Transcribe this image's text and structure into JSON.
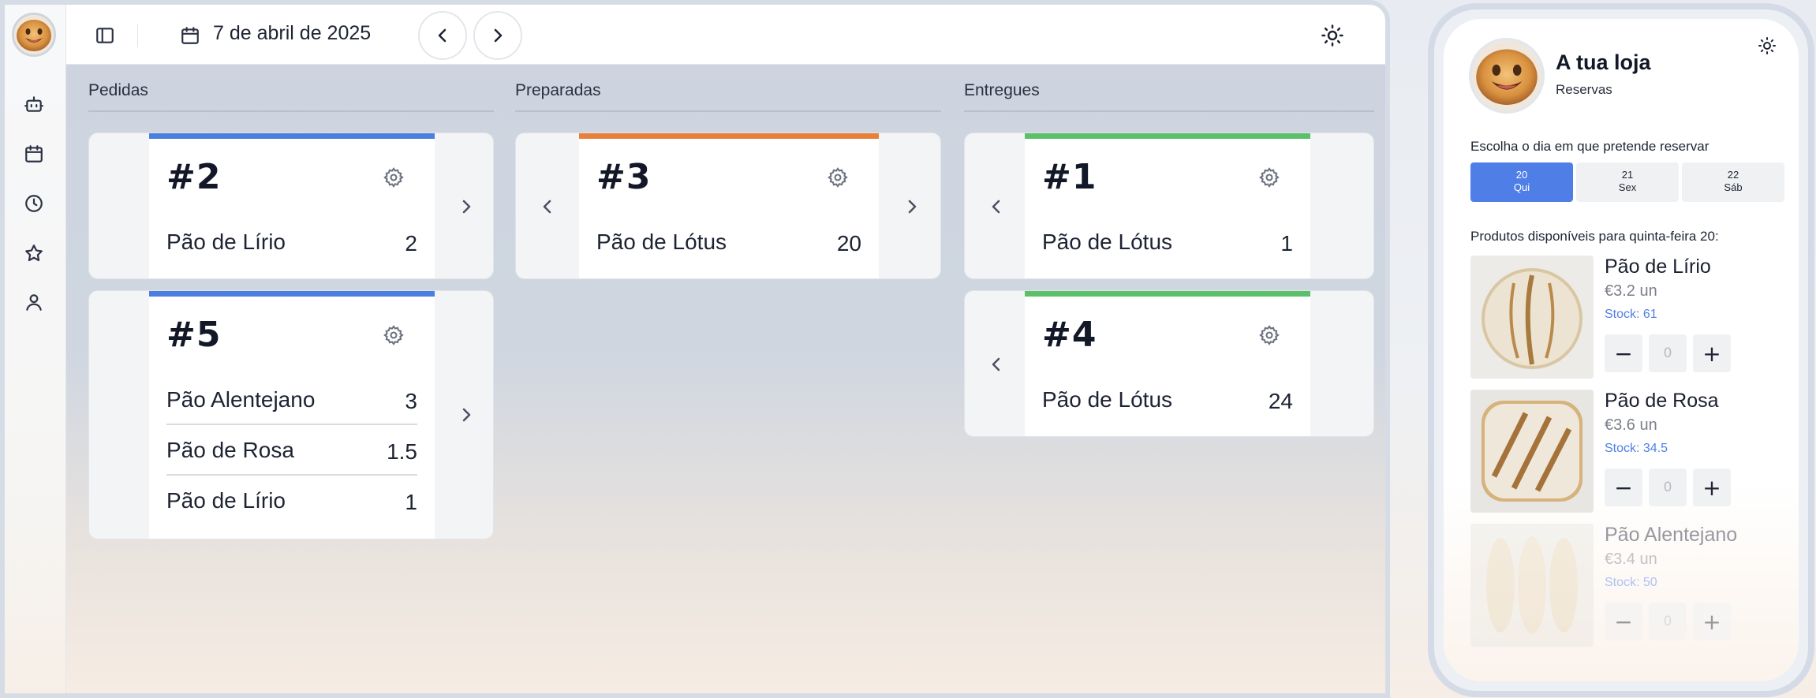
{
  "topbar": {
    "date": "7 de abril de 2025"
  },
  "columns": [
    {
      "title": "Pedidas"
    },
    {
      "title": "Preparadas"
    },
    {
      "title": "Entregues"
    }
  ],
  "orders": {
    "o2": {
      "number": "#2",
      "lines": [
        {
          "name": "Pão de Lírio",
          "qty": "2"
        }
      ]
    },
    "o5": {
      "number": "#5",
      "lines": [
        {
          "name": "Pão Alentejano",
          "qty": "3"
        },
        {
          "name": "Pão de Rosa",
          "qty": "1.5"
        },
        {
          "name": "Pão de Lírio",
          "qty": "1"
        }
      ]
    },
    "o3": {
      "number": "#3",
      "lines": [
        {
          "name": "Pão de Lótus",
          "qty": "20"
        }
      ]
    },
    "o1": {
      "number": "#1",
      "lines": [
        {
          "name": "Pão de Lótus",
          "qty": "1"
        }
      ]
    },
    "o4": {
      "number": "#4",
      "lines": [
        {
          "name": "Pão de Lótus",
          "qty": "24"
        }
      ]
    }
  },
  "colors": {
    "pedidas": "#4a7fe0",
    "preparadas": "#e8803a",
    "entregues": "#5cbf6a",
    "accent": "#4f7fe6"
  },
  "phone": {
    "store_name": "A tua loja",
    "subtitle": "Reservas",
    "choose_day": "Escolha o dia em que pretende reservar",
    "days": [
      {
        "num": "20",
        "label": "Qui"
      },
      {
        "num": "21",
        "label": "Sex"
      },
      {
        "num": "22",
        "label": "Sáb"
      }
    ],
    "available": "Produtos disponíveis para quinta-feira 20:",
    "products": [
      {
        "name": "Pão de Lírio",
        "price": "€3.2 un",
        "stock": "Stock: 61",
        "qty": "0"
      },
      {
        "name": "Pão de Rosa",
        "price": "€3.6 un",
        "stock": "Stock: 34.5",
        "qty": "0"
      },
      {
        "name": "Pão Alentejano",
        "price": "€3.4 un",
        "stock": "Stock: 50",
        "qty": "0"
      }
    ],
    "minus": "−",
    "plus": "+"
  },
  "icons": [
    "bot-icon",
    "calendar-icon",
    "clock-icon",
    "star-icon",
    "user-icon",
    "sidebar-toggle-icon",
    "sun-icon",
    "gear-icon",
    "chevron-left-icon",
    "chevron-right-icon"
  ]
}
